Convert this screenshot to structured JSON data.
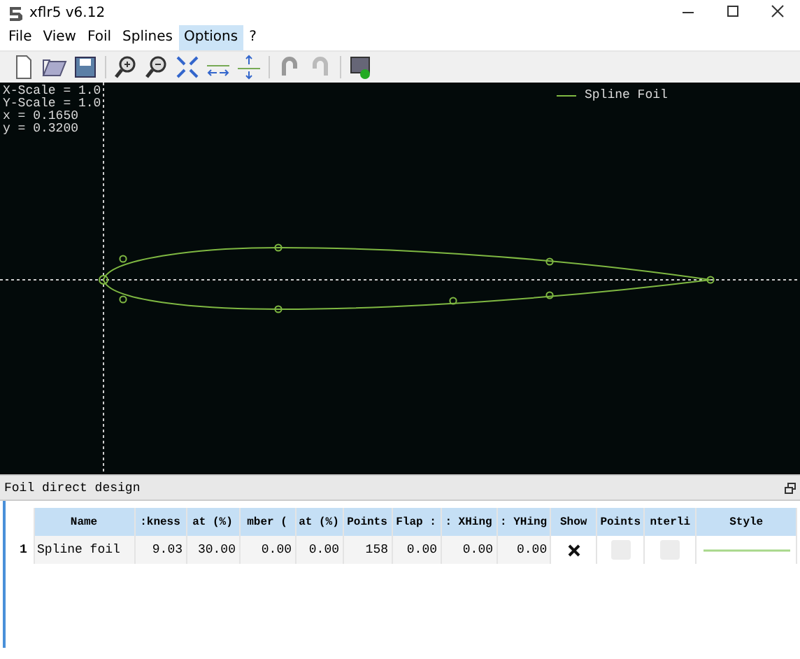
{
  "window": {
    "title": "xflr5 v6.12"
  },
  "menu": [
    {
      "label": "File",
      "selected": false
    },
    {
      "label": "View",
      "selected": false
    },
    {
      "label": "Foil",
      "selected": false
    },
    {
      "label": "Splines",
      "selected": false
    },
    {
      "label": "Options",
      "selected": true
    },
    {
      "label": "?",
      "selected": false
    }
  ],
  "plot": {
    "info": [
      "X-Scale = 1.0",
      "Y-Scale = 1.0",
      "x = 0.1650",
      "y = 0.3200"
    ],
    "legend": {
      "label": "Spline Foil",
      "color": "#7fb842"
    }
  },
  "dock": {
    "title": "Foil direct design"
  },
  "table": {
    "columns": [
      "Name",
      ":kness",
      "at (%)",
      "mber (",
      "at (%)",
      "Points",
      "Flap :",
      ": XHing",
      ": YHing",
      "Show",
      "Points",
      "nterli",
      "Style"
    ],
    "rows": [
      {
        "index": "1",
        "cells": [
          "Spline foil",
          "9.03",
          "30.00",
          "0.00",
          "0.00",
          "158",
          "0.00",
          "0.00",
          "0.00"
        ],
        "show": true,
        "points": false,
        "centerline": false,
        "color": "#a8d88a"
      }
    ]
  }
}
